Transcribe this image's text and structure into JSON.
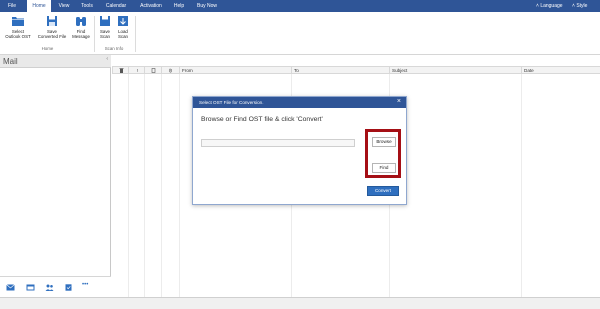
{
  "menubar": {
    "tabs": [
      {
        "label": "File"
      },
      {
        "label": "Home"
      },
      {
        "label": "View"
      },
      {
        "label": "Tools"
      },
      {
        "label": "Calendar"
      },
      {
        "label": "Activation"
      },
      {
        "label": "Help"
      },
      {
        "label": "Buy Now"
      }
    ],
    "active_tab": "Home",
    "language_label": "Language",
    "style_label": "Style",
    "color": "#2f5597"
  },
  "ribbon": {
    "home_group": {
      "label": "Home",
      "buttons": [
        {
          "line1": "Select",
          "line2": "Outlook OST",
          "icon": "folder-icon"
        },
        {
          "line1": "Save",
          "line2": "Converted File",
          "icon": "save-icon"
        },
        {
          "line1": "Find",
          "line2": "Message",
          "icon": "binoculars-icon"
        }
      ]
    },
    "scan_group": {
      "label": "Scan Info",
      "buttons": [
        {
          "line1": "Save",
          "line2": "Scan",
          "icon": "save-scan-icon"
        },
        {
          "line1": "Load",
          "line2": "Scan",
          "icon": "load-scan-icon"
        }
      ]
    }
  },
  "leftpane": {
    "title": "Mail",
    "footer_icons": [
      "mail-icon",
      "calendar-icon",
      "contacts-icon",
      "tasks-icon",
      "more-icon"
    ],
    "more_label": "•••"
  },
  "grid": {
    "columns": [
      "",
      "!",
      "",
      "",
      "From",
      "To",
      "Subject",
      "Date"
    ]
  },
  "dialog": {
    "title": "Select OST File for Conversion.",
    "close_label": "×",
    "heading": "Browse or Find OST file & click 'Convert'",
    "path_value": "",
    "browse_label": "Browse",
    "find_label": "Find",
    "convert_label": "Convert",
    "highlight_color": "#a50f15",
    "accent_color": "#2f6fbf"
  }
}
